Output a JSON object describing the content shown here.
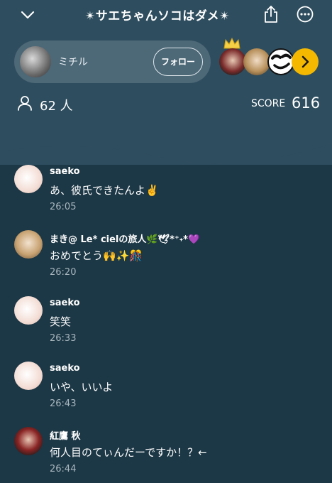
{
  "header": {
    "title": "✴サエちゃんソコはダメ✴",
    "host": {
      "name": "ミチル",
      "follow_label": "フォロー"
    },
    "viewer_count": "62 人",
    "score_label": "SCORE",
    "score_value": "616"
  },
  "messages": [
    {
      "name": "saeko",
      "text": "あ、彼氏できたんよ✌️",
      "time": "26:05"
    },
    {
      "name": "まき@ Le* cielの旅人🌿🕊*⁺˖*💜",
      "text": "おめでとう🙌✨🎊",
      "time": "26:20"
    },
    {
      "name": "saeko",
      "text": "笑笑",
      "time": "26:33"
    },
    {
      "name": "saeko",
      "text": "いや、いいよ",
      "time": "26:43"
    },
    {
      "name": "紅鷹 秋",
      "text": "何人目のてぃんだーですか！？←",
      "time": "26:44"
    }
  ],
  "colors": {
    "background": "#1c3745",
    "header_bg": "#2e4d5e",
    "pill_bg": "#4d6877",
    "accent": "#f5b800",
    "time_text": "#a9b7be"
  },
  "icons": [
    "chevron-down-icon",
    "share-icon",
    "more-icon",
    "crown-icon",
    "chevron-right-icon",
    "person-icon"
  ]
}
